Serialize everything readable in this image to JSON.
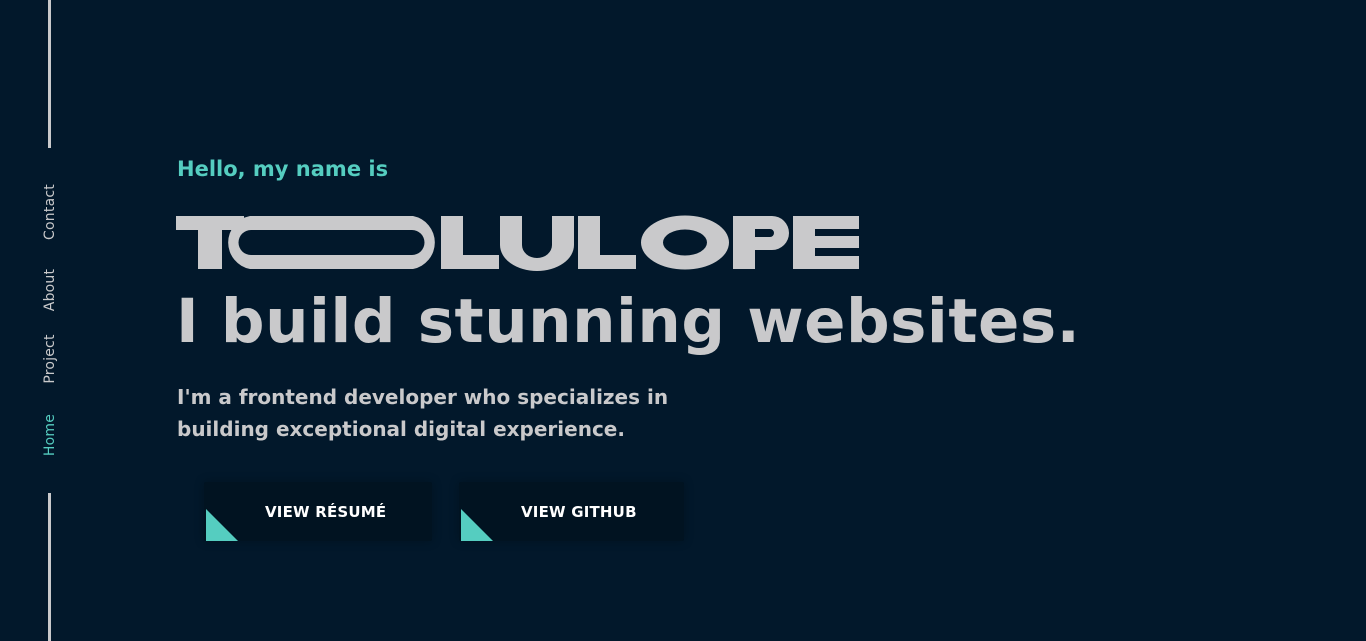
{
  "nav": {
    "items": [
      {
        "label": "Contact"
      },
      {
        "label": "About"
      },
      {
        "label": "Project"
      },
      {
        "label": "Home"
      }
    ],
    "active": "Home"
  },
  "hero": {
    "greeting": "Hello, my name is",
    "name_logo_text": "TOOLULOPE",
    "tagline": "I build stunning websites.",
    "intro": "I'm a frontend developer who specializes in building exceptional digital experience."
  },
  "buttons": {
    "resume_label": "VIEW RÉSUMÉ",
    "github_label": "VIEW GITHUB"
  },
  "colors": {
    "background": "#02182b",
    "accent": "#55cdc0",
    "text": "#c9c9cb",
    "button_bg": "#011321"
  }
}
